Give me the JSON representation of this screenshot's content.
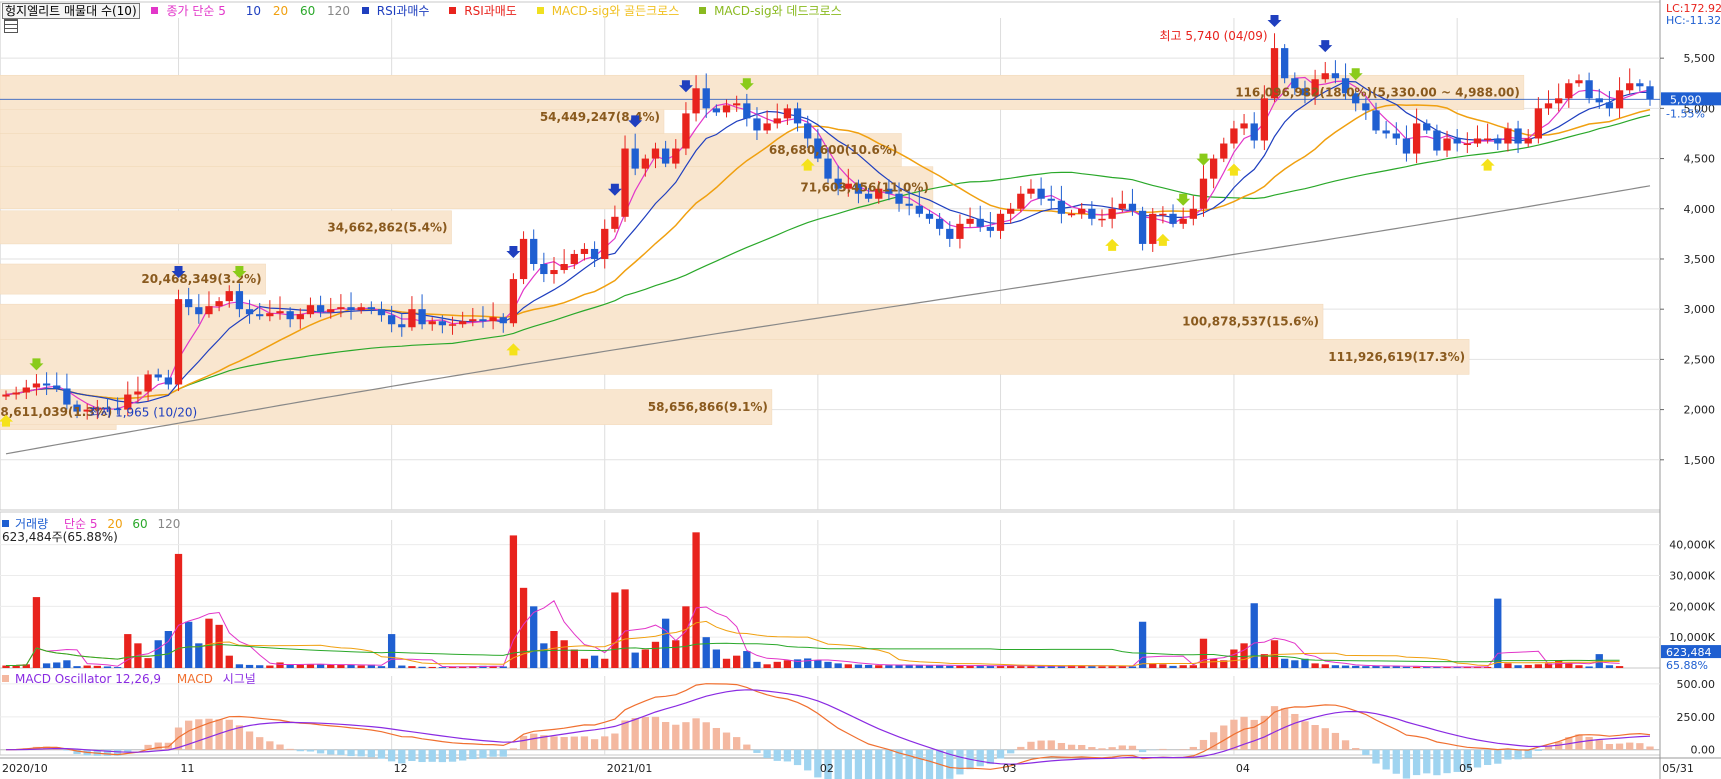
{
  "legend_price": {
    "title": "헝지엘리트 매물대 수(10)",
    "ma": "종가 단순 5",
    "ma10": "10",
    "ma20": "20",
    "ma60": "60",
    "ma120": "120",
    "rsi_buy": "RSI과매수",
    "rsi_sell": "RSI과매도",
    "golden": "MACD-sig와 골든크로스",
    "dead": "MACD-sig와 데드크로스",
    "lc": "LC:172.92",
    "hc": "HC:-11.32",
    "price_tag": "5,090",
    "pct_tag": "-1.55%"
  },
  "legend_volume": {
    "title": "거래량",
    "ma": "단순 5",
    "ma20": "20",
    "ma60": "60",
    "ma120": "120",
    "current": "623,484주(65.88%)",
    "tag": "623,484",
    "tag_pct": "65.88%"
  },
  "legend_macd": {
    "osc": "MACD Oscillator 12,26,9",
    "macd": "MACD",
    "signal": "시그널"
  },
  "annotations": {
    "high": "최고 5,740 (04/09)",
    "low": "최저 1,965 (10/20)"
  },
  "colors": {
    "up": "#e8231d",
    "down": "#1f5fd1",
    "ma5": "#e236c9",
    "ma10": "#1f3fbf",
    "ma20": "#f0a010",
    "ma60": "#2aa82a",
    "ma120": "#888888",
    "band": "#f9e6cf",
    "macd": "#8a2be2",
    "signal": "#f07030",
    "osc_up": "#f4b8a0",
    "osc_down": "#9fd4f0"
  },
  "chart_data": {
    "type": "candlestick",
    "price_axis": {
      "ylim": [
        1000,
        5900
      ],
      "ticks": [
        "1,500",
        "2,000",
        "2,500",
        "3,000",
        "3,500",
        "4,000",
        "4,500",
        "5,000",
        "5,500"
      ],
      "tick_values": [
        1500,
        2000,
        2500,
        3000,
        3500,
        4000,
        4500,
        5000,
        5500
      ]
    },
    "volume_axis": {
      "ylim": [
        0,
        48000
      ],
      "ticks": [
        "10,000K",
        "20,000K",
        "30,000K",
        "40,000K"
      ],
      "tick_values": [
        10000,
        20000,
        30000,
        40000
      ]
    },
    "macd_axis": {
      "ylim": [
        -40,
        560
      ],
      "ticks": [
        "0.00",
        "250.00",
        "500.00"
      ],
      "tick_values": [
        0,
        250,
        500
      ]
    },
    "x_labels": [
      {
        "label": "2020/10",
        "index": 0
      },
      {
        "label": "11",
        "index": 17
      },
      {
        "label": "12",
        "index": 38
      },
      {
        "label": "2021/01",
        "index": 59
      },
      {
        "label": "02",
        "index": 80
      },
      {
        "label": "03",
        "index": 98
      },
      {
        "label": "04",
        "index": 121
      },
      {
        "label": "05",
        "index": 143
      },
      {
        "label": "05/31",
        "index": 163
      }
    ],
    "volume_profile": [
      {
        "label": "8,611,039(1.3%)",
        "low": 1800,
        "high": 2150,
        "length": 0.07
      },
      {
        "label": "58,656,866(9.1%)",
        "low": 1850,
        "high": 2200,
        "length": 0.465
      },
      {
        "label": "20,468,349(3.2%)",
        "low": 3150,
        "high": 3450,
        "length": 0.16
      },
      {
        "label": "34,662,862(5.4%)",
        "low": 3650,
        "high": 3980,
        "length": 0.272
      },
      {
        "label": "100,878,537(15.6%)",
        "low": 2700,
        "high": 3050,
        "length": 0.797
      },
      {
        "label": "111,926,619(17.3%)",
        "low": 2350,
        "high": 2700,
        "length": 0.885
      },
      {
        "label": "54,449,247(8.4%)",
        "low": 4750,
        "high": 5080,
        "length": 0.4
      },
      {
        "label": "68,680,600(10.6%)",
        "low": 4420,
        "high": 4750,
        "length": 0.543
      },
      {
        "label": "71,603,456(11.0%)",
        "low": 4000,
        "high": 4420,
        "length": 0.562
      },
      {
        "label": "116,096,982(18.0%)(5,330.00 ~ 4,988.00)",
        "low": 4988,
        "high": 5330,
        "length": 0.918
      }
    ],
    "close": [
      2150,
      2170,
      2220,
      2260,
      2240,
      2210,
      2050,
      1980,
      2000,
      2020,
      2010,
      2000,
      2150,
      2180,
      2350,
      2320,
      2250,
      3100,
      3020,
      2950,
      3030,
      3080,
      3180,
      3000,
      2950,
      2930,
      2960,
      2980,
      2900,
      2950,
      3040,
      2970,
      3000,
      3020,
      2990,
      3020,
      3000,
      2940,
      2850,
      2820,
      3000,
      2850,
      2880,
      2840,
      2850,
      2880,
      2900,
      2880,
      2920,
      2860,
      3300,
      3700,
      3450,
      3350,
      3390,
      3450,
      3550,
      3600,
      3500,
      3800,
      3920,
      4600,
      4400,
      4500,
      4600,
      4450,
      4600,
      4950,
      5200,
      5000,
      4960,
      5030,
      5050,
      4900,
      4780,
      4850,
      4900,
      5000,
      4850,
      4700,
      4500,
      4300,
      4200,
      4250,
      4150,
      4100,
      4200,
      4150,
      4050,
      4030,
      3950,
      3900,
      3800,
      3700,
      3850,
      3900,
      3820,
      3780,
      3950,
      4000,
      4150,
      4200,
      4100,
      4080,
      3950,
      3950,
      4000,
      3900,
      3900,
      4000,
      4050,
      3980,
      3650,
      3950,
      3950,
      3850,
      3900,
      4000,
      4300,
      4500,
      4650,
      4800,
      4850,
      4680,
      5100,
      5600,
      5300,
      5200,
      5130,
      5290,
      5350,
      5300,
      5150,
      5050,
      4980,
      4780,
      4750,
      4700,
      4550,
      4850,
      4780,
      4580,
      4700,
      4650,
      4650,
      4700,
      4700,
      4650,
      4800,
      4650,
      4700,
      5000,
      5050,
      5100,
      5250,
      5280,
      5100,
      5060,
      5000,
      5180,
      5250,
      5220,
      5090
    ],
    "volume_k": [
      800,
      900,
      1200,
      23000,
      1500,
      1800,
      2500,
      600,
      800,
      700,
      500,
      300,
      11000,
      8000,
      3200,
      9000,
      12000,
      37000,
      15000,
      8000,
      16000,
      14000,
      4000,
      1200,
      1000,
      900,
      800,
      1800,
      1100,
      1000,
      1300,
      1200,
      1000,
      1000,
      1000,
      800,
      1100,
      600,
      11000,
      800,
      600,
      400,
      350,
      300,
      400,
      500,
      600,
      700,
      600,
      500,
      43000,
      26000,
      20000,
      8000,
      12000,
      9000,
      6000,
      3000,
      4000,
      3000,
      24500,
      25500,
      5000,
      6000,
      8500,
      16000,
      9000,
      20000,
      44000,
      10000,
      6000,
      3000,
      4000,
      5500,
      2000,
      1200,
      2000,
      2500,
      2800,
      3100,
      2500,
      2000,
      1500,
      1200,
      1100,
      1000,
      900,
      900,
      1000,
      1000,
      900,
      800,
      900,
      700,
      700,
      800,
      900,
      700,
      700,
      800,
      600,
      500,
      500,
      600,
      800,
      900,
      800,
      600,
      500,
      600,
      700,
      500,
      15000,
      1500,
      1200,
      700,
      900,
      900,
      9500,
      3000,
      2500,
      6000,
      8000,
      21000,
      4500,
      9000,
      3000,
      2500,
      3000,
      1500,
      1200,
      900,
      800,
      700,
      600,
      800,
      500,
      600,
      400,
      400,
      300,
      350,
      400,
      300,
      400,
      300,
      350,
      22500,
      1500,
      900,
      1000,
      1200,
      1500,
      2500,
      1500,
      900,
      500,
      4500,
      900,
      623
    ]
  }
}
